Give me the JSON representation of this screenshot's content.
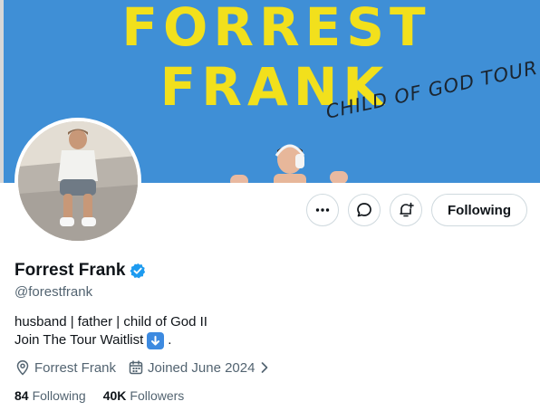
{
  "banner": {
    "title_line1": "FORREST",
    "title_line2": "FRANK",
    "subtitle": "CHILD OF GOD TOUR",
    "colors": {
      "background": "#3f8fd6",
      "title": "#f2e01c"
    }
  },
  "profile": {
    "display_name": "Forrest Frank",
    "verified_icon": "verified-badge-icon",
    "handle": "@forestfrank",
    "bio_line1": "husband | father | child of God II",
    "bio_line2": "Join The Tour Waitlist",
    "bio_line2_end": ".",
    "bio_emoji": "down-arrow-emoji-icon",
    "location": "Forrest Frank",
    "joined": "Joined June 2024"
  },
  "actions": {
    "more_icon": "more-icon",
    "message_icon": "message-icon",
    "notify_icon": "notification-bell-icon",
    "following_label": "Following"
  },
  "stats": {
    "following_count": "84",
    "following_label": "Following",
    "followers_count": "40K",
    "followers_label": "Followers"
  },
  "colors": {
    "verified": "#1d9bf0",
    "secondary_text": "#536471",
    "primary_text": "#0f1419"
  }
}
